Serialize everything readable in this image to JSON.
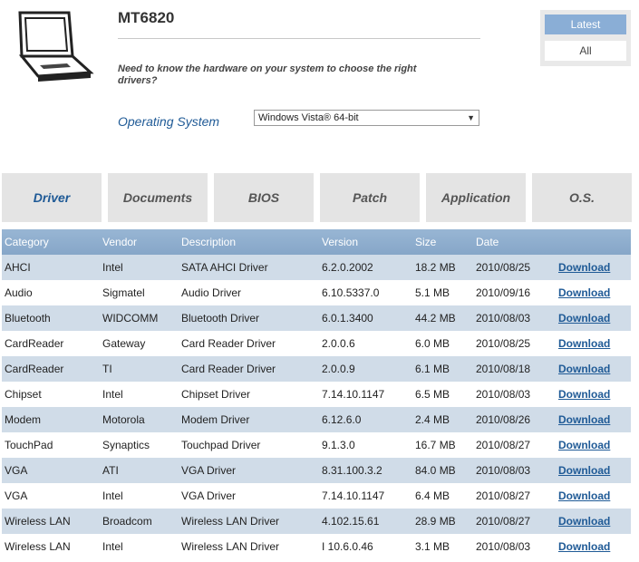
{
  "header": {
    "model": "MT6820",
    "hint": "Need to know the hardware on your system to choose the right drivers?",
    "os_label": "Operating System",
    "os_selected": "Windows Vista® 64-bit"
  },
  "filters": {
    "latest": "Latest",
    "all": "All"
  },
  "tabs": [
    "Driver",
    "Documents",
    "BIOS",
    "Patch",
    "Application",
    "O.S."
  ],
  "table": {
    "headers": [
      "Category",
      "Vendor",
      "Description",
      "Version",
      "Size",
      "Date"
    ],
    "download_label": "Download",
    "rows": [
      [
        "AHCI",
        "Intel",
        "SATA AHCI Driver",
        "6.2.0.2002",
        "18.2 MB",
        "2010/08/25"
      ],
      [
        "Audio",
        "Sigmatel",
        "Audio Driver",
        "6.10.5337.0",
        "5.1 MB",
        "2010/09/16"
      ],
      [
        "Bluetooth",
        "WIDCOMM",
        "Bluetooth Driver",
        "6.0.1.3400",
        "44.2 MB",
        "2010/08/03"
      ],
      [
        "CardReader",
        "Gateway",
        "Card Reader Driver",
        "2.0.0.6",
        "6.0 MB",
        "2010/08/25"
      ],
      [
        "CardReader",
        "TI",
        "Card Reader Driver",
        "2.0.0.9",
        "6.1 MB",
        "2010/08/18"
      ],
      [
        "Chipset",
        "Intel",
        "Chipset Driver",
        "7.14.10.1147",
        "6.5 MB",
        "2010/08/03"
      ],
      [
        "Modem",
        "Motorola",
        "Modem Driver",
        "6.12.6.0",
        "2.4 MB",
        "2010/08/26"
      ],
      [
        "TouchPad",
        "Synaptics",
        "Touchpad Driver",
        "9.1.3.0",
        "16.7 MB",
        "2010/08/27"
      ],
      [
        "VGA",
        "ATI",
        "VGA Driver",
        "8.31.100.3.2",
        "84.0 MB",
        "2010/08/03"
      ],
      [
        "VGA",
        "Intel",
        "VGA Driver",
        "7.14.10.1147",
        "6.4 MB",
        "2010/08/27"
      ],
      [
        "Wireless LAN",
        "Broadcom",
        "Wireless LAN Driver",
        "4.102.15.61",
        "28.9 MB",
        "2010/08/27"
      ],
      [
        "Wireless LAN",
        "Intel",
        "Wireless LAN Driver",
        "I 10.6.0.46",
        "3.1 MB",
        "2010/08/03"
      ]
    ]
  }
}
